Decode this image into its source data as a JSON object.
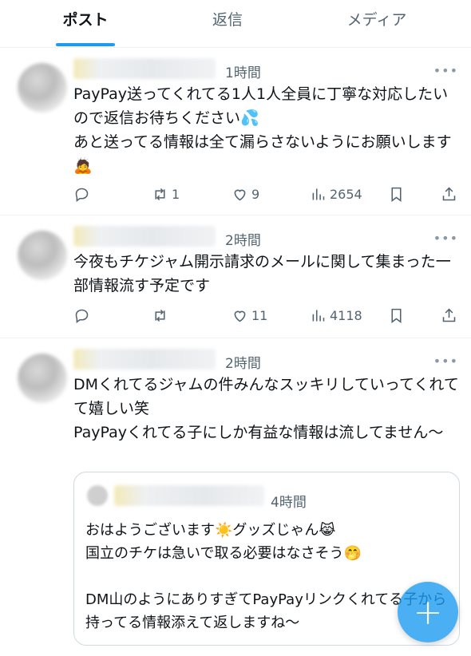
{
  "tabs": [
    {
      "label": "ポスト",
      "active": true
    },
    {
      "label": "返信",
      "active": false
    },
    {
      "label": "メディア",
      "active": false
    }
  ],
  "tweets": [
    {
      "time": "1時間",
      "text": "PayPay送ってくれてる1人1人全員に丁寧な対応したいので返信お待ちください💦\nあと送ってる情報は全て漏らさないようにお願いします🙇",
      "replies": "",
      "retweets": "1",
      "likes": "9",
      "views": "2654"
    },
    {
      "time": "2時間",
      "text": "今夜もチケジャム開示請求のメールに関して集まった一部情報流す予定です",
      "replies": "",
      "retweets": "",
      "likes": "11",
      "views": "4118"
    },
    {
      "time": "2時間",
      "text": "DMくれてるジャムの件みんなスッキリしていってくれてて嬉しい笑\nPayPayくれてる子にしか有益な情報は流してません〜",
      "quote": {
        "time": "4時間",
        "text": "おはようございます☀️グッズじゃん😹\n国立のチケは急いで取る必要はなさそう🤭\n\nDM山のようにありすぎてPayPayリンクくれてる子から持ってる情報添えて返しますね〜"
      }
    }
  ],
  "icons": {
    "more": "more-icon",
    "reply": "reply-icon",
    "retweet": "retweet-icon",
    "like": "heart-icon",
    "views": "views-icon",
    "bookmark": "bookmark-icon",
    "share": "share-icon",
    "compose": "plus-icon"
  },
  "colors": {
    "accent": "#1d9bf0",
    "secondary_text": "#536471"
  }
}
